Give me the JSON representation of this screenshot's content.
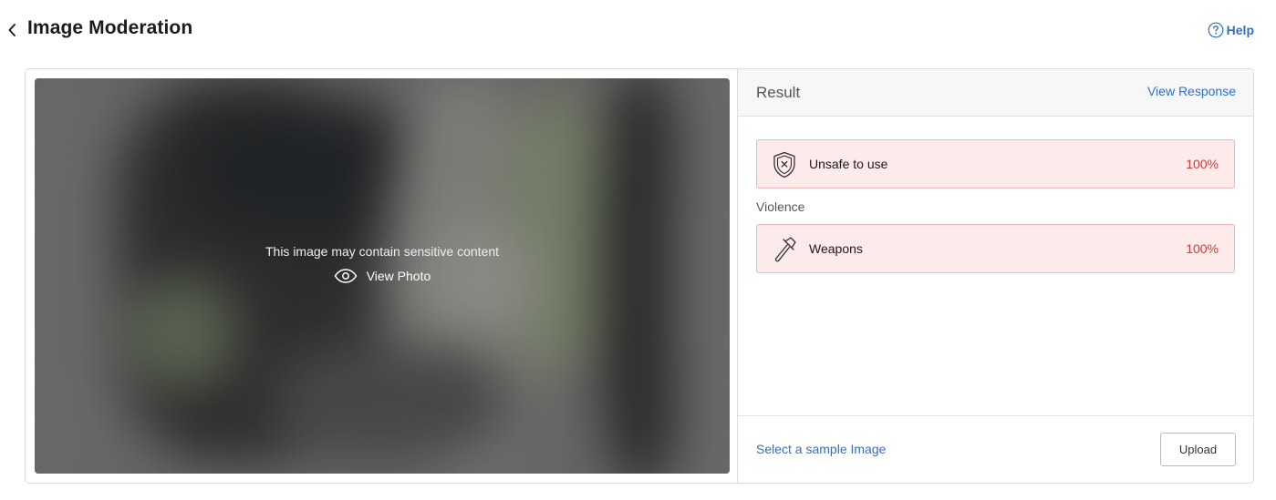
{
  "header": {
    "title": "Image Moderation",
    "help_label": "Help"
  },
  "image_panel": {
    "sensitive_message": "This image may contain sensitive content",
    "view_photo_label": "View Photo"
  },
  "result": {
    "title": "Result",
    "view_response_label": "View Response",
    "overall": {
      "label": "Unsafe to use",
      "value": "100%",
      "icon": "shield-x-icon"
    },
    "category_label": "Violence",
    "categories": [
      {
        "label": "Weapons",
        "value": "100%",
        "icon": "hammer-icon"
      }
    ]
  },
  "footer": {
    "sample_link_label": "Select a sample Image",
    "upload_label": "Upload"
  },
  "colors": {
    "link": "#2f6fc4",
    "danger_text": "#d03b3b",
    "danger_bg": "#fdeaea",
    "danger_border": "#f0b5b5"
  }
}
